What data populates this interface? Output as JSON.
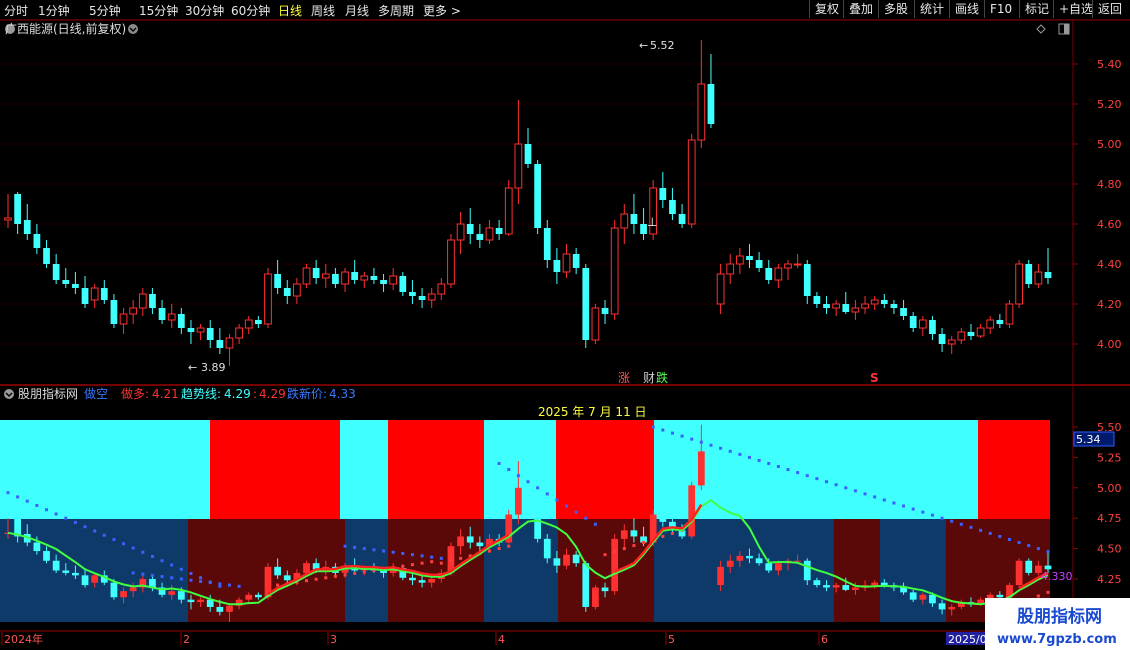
{
  "toolbar": {
    "left_items": [
      "分时",
      "1分钟",
      "5分钟",
      "15分钟",
      "30分钟",
      "60分钟",
      "日线",
      "周线",
      "月线",
      "多周期",
      "更多 >"
    ],
    "active_item": "日线",
    "right_items": [
      "复权",
      "叠加",
      "多股",
      "统计",
      "画线",
      "F10",
      "标记",
      "+自选",
      "返回"
    ]
  },
  "main_chart": {
    "title": "广西能源(日线,前复权)",
    "price_axis": [
      "5.40",
      "5.20",
      "5.00",
      "4.80",
      "4.60",
      "4.40",
      "4.20",
      "4.00"
    ],
    "high_label": "5.52",
    "low_label": "3.89",
    "markers": {
      "zhang": "涨",
      "cai": "财",
      "die": "跌",
      "s": "S"
    }
  },
  "indicator": {
    "name": "股朋指标网",
    "kongkong_label": "做空",
    "zuoduo_label": "做多:",
    "zuoduo_value": "4.21",
    "trend_label": "趋势线:",
    "trend_value": "4.29",
    "sep_value": "4.29",
    "new_price_label": "跌新价:",
    "new_price_value": "4.33",
    "date_label": "2025 年 7 月 11 日",
    "axis": [
      "5.50",
      "5.25",
      "5.00",
      "4.75",
      "4.50",
      "4.25"
    ],
    "current_box": "5.34",
    "right_value": "4.330"
  },
  "time_axis": [
    "2024年",
    "2",
    "3",
    "4",
    "5",
    "6",
    "2025/0"
  ],
  "watermark": {
    "title": "股朋指标网",
    "url": "www.7gpzb.com"
  },
  "chart_data": {
    "type": "candlestick",
    "title": "",
    "ylim": [
      3.85,
      5.6
    ],
    "candles": [
      [
        4.62,
        4.75,
        4.58,
        4.63
      ],
      [
        4.75,
        4.76,
        4.55,
        4.6
      ],
      [
        4.62,
        4.7,
        4.52,
        4.55
      ],
      [
        4.55,
        4.6,
        4.45,
        4.48
      ],
      [
        4.48,
        4.52,
        4.38,
        4.4
      ],
      [
        4.4,
        4.45,
        4.3,
        4.32
      ],
      [
        4.32,
        4.38,
        4.28,
        4.3
      ],
      [
        4.3,
        4.36,
        4.25,
        4.28
      ],
      [
        4.28,
        4.34,
        4.18,
        4.2
      ],
      [
        4.22,
        4.3,
        4.18,
        4.28
      ],
      [
        4.28,
        4.32,
        4.2,
        4.22
      ],
      [
        4.22,
        4.25,
        4.08,
        4.1
      ],
      [
        4.1,
        4.18,
        4.05,
        4.15
      ],
      [
        4.15,
        4.22,
        4.1,
        4.18
      ],
      [
        4.18,
        4.28,
        4.14,
        4.25
      ],
      [
        4.25,
        4.28,
        4.15,
        4.18
      ],
      [
        4.18,
        4.22,
        4.1,
        4.12
      ],
      [
        4.12,
        4.2,
        4.08,
        4.15
      ],
      [
        4.15,
        4.18,
        4.05,
        4.08
      ],
      [
        4.08,
        4.12,
        4.0,
        4.06
      ],
      [
        4.06,
        4.1,
        4.02,
        4.08
      ],
      [
        4.08,
        4.12,
        3.98,
        4.02
      ],
      [
        4.02,
        4.08,
        3.95,
        3.98
      ],
      [
        3.98,
        4.05,
        3.89,
        4.03
      ],
      [
        4.03,
        4.1,
        4.0,
        4.08
      ],
      [
        4.08,
        4.14,
        4.05,
        4.12
      ],
      [
        4.12,
        4.14,
        4.08,
        4.1
      ],
      [
        4.1,
        4.38,
        4.08,
        4.35
      ],
      [
        4.35,
        4.42,
        4.25,
        4.28
      ],
      [
        4.28,
        4.32,
        4.2,
        4.24
      ],
      [
        4.24,
        4.33,
        4.2,
        4.3
      ],
      [
        4.3,
        4.4,
        4.28,
        4.38
      ],
      [
        4.38,
        4.42,
        4.3,
        4.33
      ],
      [
        4.33,
        4.4,
        4.28,
        4.35
      ],
      [
        4.35,
        4.38,
        4.28,
        4.3
      ],
      [
        4.3,
        4.38,
        4.26,
        4.36
      ],
      [
        4.36,
        4.42,
        4.3,
        4.32
      ],
      [
        4.32,
        4.36,
        4.28,
        4.34
      ],
      [
        4.34,
        4.38,
        4.3,
        4.32
      ],
      [
        4.32,
        4.35,
        4.26,
        4.3
      ],
      [
        4.3,
        4.38,
        4.27,
        4.34
      ],
      [
        4.34,
        4.36,
        4.24,
        4.26
      ],
      [
        4.26,
        4.32,
        4.2,
        4.24
      ],
      [
        4.24,
        4.28,
        4.18,
        4.22
      ],
      [
        4.22,
        4.28,
        4.18,
        4.25
      ],
      [
        4.25,
        4.33,
        4.22,
        4.3
      ],
      [
        4.3,
        4.55,
        4.28,
        4.52
      ],
      [
        4.52,
        4.66,
        4.45,
        4.6
      ],
      [
        4.6,
        4.68,
        4.5,
        4.55
      ],
      [
        4.55,
        4.6,
        4.48,
        4.52
      ],
      [
        4.52,
        4.62,
        4.5,
        4.58
      ],
      [
        4.58,
        4.62,
        4.52,
        4.55
      ],
      [
        4.55,
        4.82,
        4.54,
        4.78
      ],
      [
        4.78,
        5.22,
        4.7,
        5.0
      ],
      [
        5.0,
        5.08,
        4.88,
        4.9
      ],
      [
        4.9,
        4.92,
        4.55,
        4.58
      ],
      [
        4.58,
        4.62,
        4.38,
        4.42
      ],
      [
        4.42,
        4.48,
        4.3,
        4.36
      ],
      [
        4.36,
        4.5,
        4.33,
        4.45
      ],
      [
        4.45,
        4.48,
        4.35,
        4.38
      ],
      [
        4.38,
        4.4,
        3.98,
        4.02
      ],
      [
        4.02,
        4.2,
        4.0,
        4.18
      ],
      [
        4.18,
        4.22,
        4.1,
        4.15
      ],
      [
        4.15,
        4.62,
        4.12,
        4.58
      ],
      [
        4.58,
        4.7,
        4.5,
        4.65
      ],
      [
        4.65,
        4.75,
        4.55,
        4.6
      ],
      [
        4.6,
        4.68,
        4.52,
        4.55
      ],
      [
        4.55,
        4.82,
        4.52,
        4.78
      ],
      [
        4.78,
        4.86,
        4.68,
        4.72
      ],
      [
        4.72,
        4.78,
        4.62,
        4.65
      ],
      [
        4.65,
        4.7,
        4.58,
        4.6
      ],
      [
        4.6,
        5.05,
        4.58,
        5.02
      ],
      [
        5.02,
        5.52,
        4.98,
        5.3
      ],
      [
        5.3,
        5.45,
        5.08,
        5.1
      ],
      [
        4.2,
        4.4,
        4.15,
        4.35
      ],
      [
        4.35,
        4.45,
        4.3,
        4.4
      ],
      [
        4.4,
        4.48,
        4.35,
        4.44
      ],
      [
        4.44,
        4.5,
        4.38,
        4.42
      ],
      [
        4.42,
        4.46,
        4.36,
        4.38
      ],
      [
        4.38,
        4.42,
        4.3,
        4.32
      ],
      [
        4.32,
        4.4,
        4.28,
        4.38
      ],
      [
        4.38,
        4.42,
        4.32,
        4.4
      ],
      [
        4.4,
        4.45,
        4.38,
        4.4
      ],
      [
        4.4,
        4.42,
        4.2,
        4.24
      ],
      [
        4.24,
        4.26,
        4.18,
        4.2
      ],
      [
        4.2,
        4.24,
        4.15,
        4.18
      ],
      [
        4.18,
        4.22,
        4.14,
        4.2
      ],
      [
        4.2,
        4.26,
        4.15,
        4.16
      ],
      [
        4.16,
        4.22,
        4.12,
        4.18
      ],
      [
        4.18,
        4.24,
        4.15,
        4.2
      ],
      [
        4.2,
        4.24,
        4.17,
        4.22
      ],
      [
        4.22,
        4.25,
        4.18,
        4.2
      ],
      [
        4.2,
        4.22,
        4.15,
        4.18
      ],
      [
        4.18,
        4.22,
        4.12,
        4.14
      ],
      [
        4.14,
        4.16,
        4.06,
        4.08
      ],
      [
        4.08,
        4.14,
        4.04,
        4.12
      ],
      [
        4.12,
        4.14,
        4.02,
        4.05
      ],
      [
        4.05,
        4.08,
        3.96,
        4.0
      ],
      [
        4.0,
        4.04,
        3.95,
        4.02
      ],
      [
        4.02,
        4.08,
        4.0,
        4.06
      ],
      [
        4.06,
        4.1,
        4.02,
        4.04
      ],
      [
        4.04,
        4.1,
        4.03,
        4.08
      ],
      [
        4.08,
        4.14,
        4.05,
        4.12
      ],
      [
        4.12,
        4.15,
        4.08,
        4.1
      ],
      [
        4.1,
        4.22,
        4.08,
        4.2
      ],
      [
        4.2,
        4.42,
        4.18,
        4.4
      ],
      [
        4.4,
        4.42,
        4.28,
        4.3
      ],
      [
        4.3,
        4.4,
        4.28,
        4.36
      ],
      [
        4.36,
        4.48,
        4.3,
        4.33
      ]
    ]
  }
}
